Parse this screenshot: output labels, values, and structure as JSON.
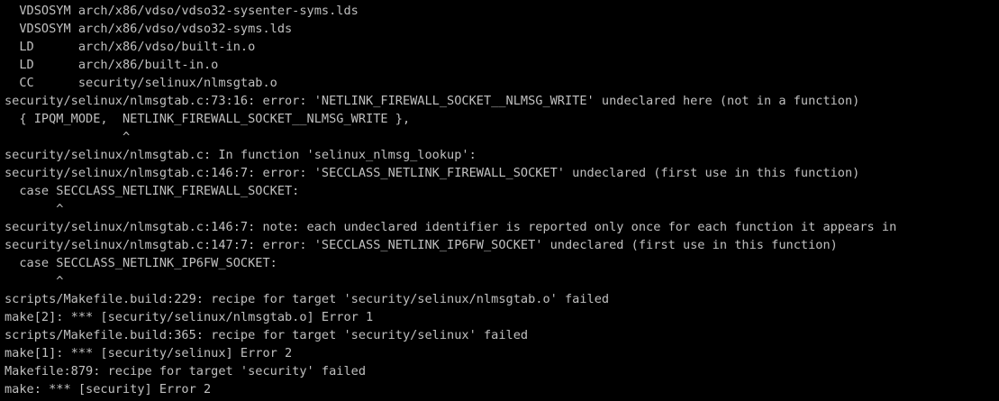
{
  "terminal": {
    "lines": [
      "  VDSOSYM arch/x86/vdso/vdso32-sysenter-syms.lds",
      "  VDSOSYM arch/x86/vdso/vdso32-syms.lds",
      "  LD      arch/x86/vdso/built-in.o",
      "  LD      arch/x86/built-in.o",
      "  CC      security/selinux/nlmsgtab.o",
      "security/selinux/nlmsgtab.c:73:16: error: 'NETLINK_FIREWALL_SOCKET__NLMSG_WRITE' undeclared here (not in a function)",
      "  { IPQM_MODE,  NETLINK_FIREWALL_SOCKET__NLMSG_WRITE },",
      "                ^",
      "security/selinux/nlmsgtab.c: In function 'selinux_nlmsg_lookup':",
      "security/selinux/nlmsgtab.c:146:7: error: 'SECCLASS_NETLINK_FIREWALL_SOCKET' undeclared (first use in this function)",
      "  case SECCLASS_NETLINK_FIREWALL_SOCKET:",
      "       ^",
      "security/selinux/nlmsgtab.c:146:7: note: each undeclared identifier is reported only once for each function it appears in",
      "security/selinux/nlmsgtab.c:147:7: error: 'SECCLASS_NETLINK_IP6FW_SOCKET' undeclared (first use in this function)",
      "  case SECCLASS_NETLINK_IP6FW_SOCKET:",
      "       ^",
      "scripts/Makefile.build:229: recipe for target 'security/selinux/nlmsgtab.o' failed",
      "make[2]: *** [security/selinux/nlmsgtab.o] Error 1",
      "scripts/Makefile.build:365: recipe for target 'security/selinux' failed",
      "make[1]: *** [security/selinux] Error 2",
      "Makefile:879: recipe for target 'security' failed",
      "make: *** [security] Error 2"
    ]
  }
}
